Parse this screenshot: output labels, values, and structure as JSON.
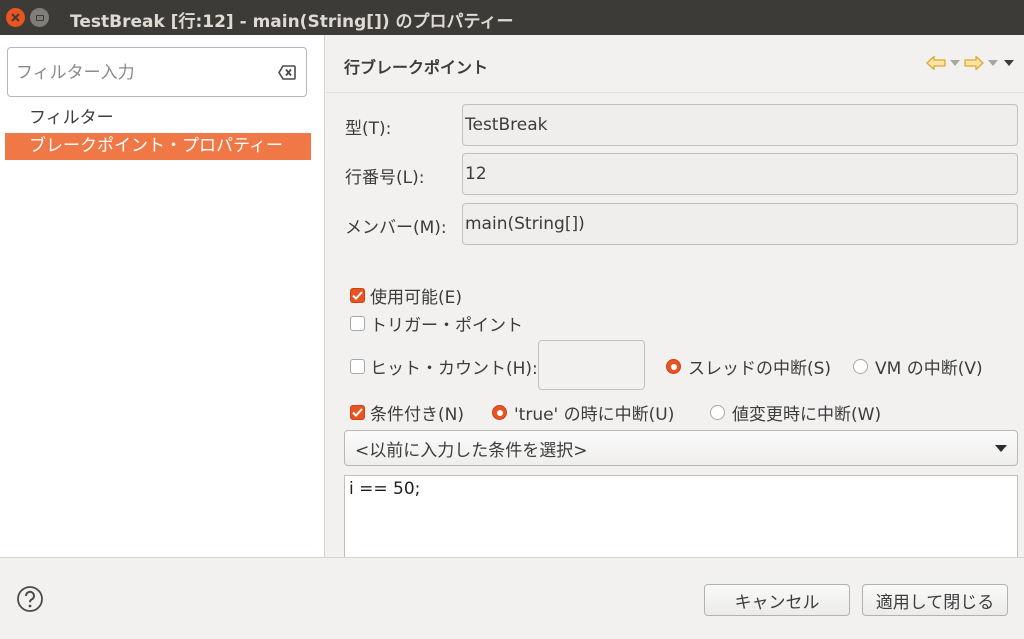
{
  "window": {
    "title": "TestBreak [行:12] - main(String[]) のプロパティー"
  },
  "sidebar": {
    "filter_placeholder": "フィルター入力",
    "items": [
      {
        "label": "フィルター",
        "selected": false
      },
      {
        "label": "ブレークポイント・プロパティー",
        "selected": true
      }
    ]
  },
  "page": {
    "title": "行ブレークポイント",
    "fields": {
      "type_label": "型(T):",
      "type_value": "TestBreak",
      "line_label": "行番号(L):",
      "line_value": "12",
      "member_label": "メンバー(M):",
      "member_value": "main(String[])"
    },
    "options": {
      "enabled_label": "使用可能(E)",
      "enabled_checked": true,
      "trigger_label": "トリガー・ポイント",
      "trigger_checked": false,
      "hitcount_label": "ヒット・カウント(H):",
      "hitcount_checked": false,
      "hitcount_value": "",
      "suspend_thread_label": "スレッドの中断(S)",
      "suspend_thread_selected": true,
      "suspend_vm_label": "VM の中断(V)",
      "suspend_vm_selected": false,
      "conditional_label": "条件付き(N)",
      "conditional_checked": true,
      "cond_true_label": "'true' の時に中断(U)",
      "cond_true_selected": true,
      "cond_change_label": "値変更時に中断(W)",
      "cond_change_selected": false
    },
    "condition_history_placeholder": "<以前に入力した条件を選択>",
    "condition_text": "i == 50;"
  },
  "footer": {
    "cancel_label": "キャンセル",
    "apply_close_label": "適用して閉じる"
  },
  "colors": {
    "accent": "#e95420",
    "selection": "#f07746",
    "titlebar": "#3c3b37",
    "nav_arrow": "#f2c14e"
  }
}
